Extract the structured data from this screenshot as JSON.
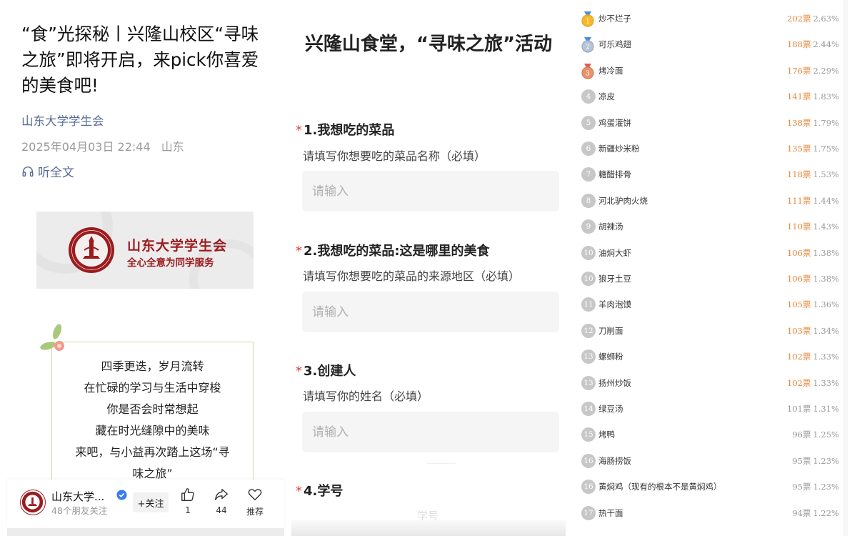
{
  "article": {
    "title": "“食”光探秘丨兴隆山校区“寻味之旅”即将开启，来pick你喜爱的美食吧!",
    "author": "山东大学学生会",
    "date": "2025年04月03日 22:44",
    "location": "山东",
    "listen_label": "听全文",
    "banner": {
      "line1": "山东大学学生会",
      "line2": "全心全意为同学服务"
    },
    "poem": [
      "四季更迭，岁月流转",
      "在忙碌的学习与生活中穿梭",
      "你是否会时常想起",
      "藏在时光缝隙中的美味",
      "来吧，与小益再次踏上这场“寻",
      "味之旅”"
    ],
    "bottom_bar": {
      "account_name": "山东大学...",
      "friends_followed": "48个朋友关注",
      "follow_label": "+关注",
      "like_count": "1",
      "share_count": "44",
      "recommend_label": "推荐"
    }
  },
  "form": {
    "title": "兴隆山食堂，“寻味之旅”活动",
    "required_mark": "*",
    "placeholder": "请输入",
    "questions": [
      {
        "label": "1.我想吃的菜品",
        "desc": "请填写你想要吃的菜品名称（必填）"
      },
      {
        "label": "2.我想吃的菜品:这是哪里的美食",
        "desc": "请填写你想要吃的菜品的来源地区（必填）"
      },
      {
        "label": "3.创建人",
        "desc": "请填写你的姓名（必填）"
      },
      {
        "label": "4.学号",
        "desc": ""
      }
    ],
    "bottom_text": "学号"
  },
  "ranking": {
    "accent_color": "#e8893c",
    "items": [
      {
        "rank": "1",
        "name": "炒不烂子",
        "votes": "202票",
        "pct": "2.63%"
      },
      {
        "rank": "2",
        "name": "可乐鸡翅",
        "votes": "188票",
        "pct": "2.44%"
      },
      {
        "rank": "3",
        "name": "烤冷面",
        "votes": "176票",
        "pct": "2.29%"
      },
      {
        "rank": "4",
        "name": "凉皮",
        "votes": "141票",
        "pct": "1.83%"
      },
      {
        "rank": "5",
        "name": "鸡蛋灌饼",
        "votes": "138票",
        "pct": "1.79%"
      },
      {
        "rank": "6",
        "name": "新疆炒米粉",
        "votes": "135票",
        "pct": "1.75%"
      },
      {
        "rank": "7",
        "name": "糖醋排骨",
        "votes": "118票",
        "pct": "1.53%"
      },
      {
        "rank": "8",
        "name": "河北驴肉火烧",
        "votes": "111票",
        "pct": "1.44%"
      },
      {
        "rank": "9",
        "name": "胡辣汤",
        "votes": "110票",
        "pct": "1.43%"
      },
      {
        "rank": "10",
        "name": "油焖大虾",
        "votes": "106票",
        "pct": "1.38%"
      },
      {
        "rank": "10",
        "name": "狼牙土豆",
        "votes": "106票",
        "pct": "1.38%"
      },
      {
        "rank": "11",
        "name": "羊肉泡馍",
        "votes": "105票",
        "pct": "1.36%"
      },
      {
        "rank": "12",
        "name": "刀削面",
        "votes": "103票",
        "pct": "1.34%"
      },
      {
        "rank": "13",
        "name": "螺蛳粉",
        "votes": "102票",
        "pct": "1.33%"
      },
      {
        "rank": "13",
        "name": "扬州炒饭",
        "votes": "102票",
        "pct": "1.33%"
      },
      {
        "rank": "14",
        "name": "绿豆汤",
        "votes": "101票",
        "pct": "1.31%"
      },
      {
        "rank": "15",
        "name": "烤鸭",
        "votes": "96票",
        "pct": "1.25%"
      },
      {
        "rank": "16",
        "name": "海肠捞饭",
        "votes": "95票",
        "pct": "1.23%"
      },
      {
        "rank": "16",
        "name": "黄焖鸡（现有的根本不是黄焖鸡）",
        "votes": "95票",
        "pct": "1.23%"
      },
      {
        "rank": "17",
        "name": "热干面",
        "votes": "94票",
        "pct": "1.22%"
      }
    ]
  }
}
